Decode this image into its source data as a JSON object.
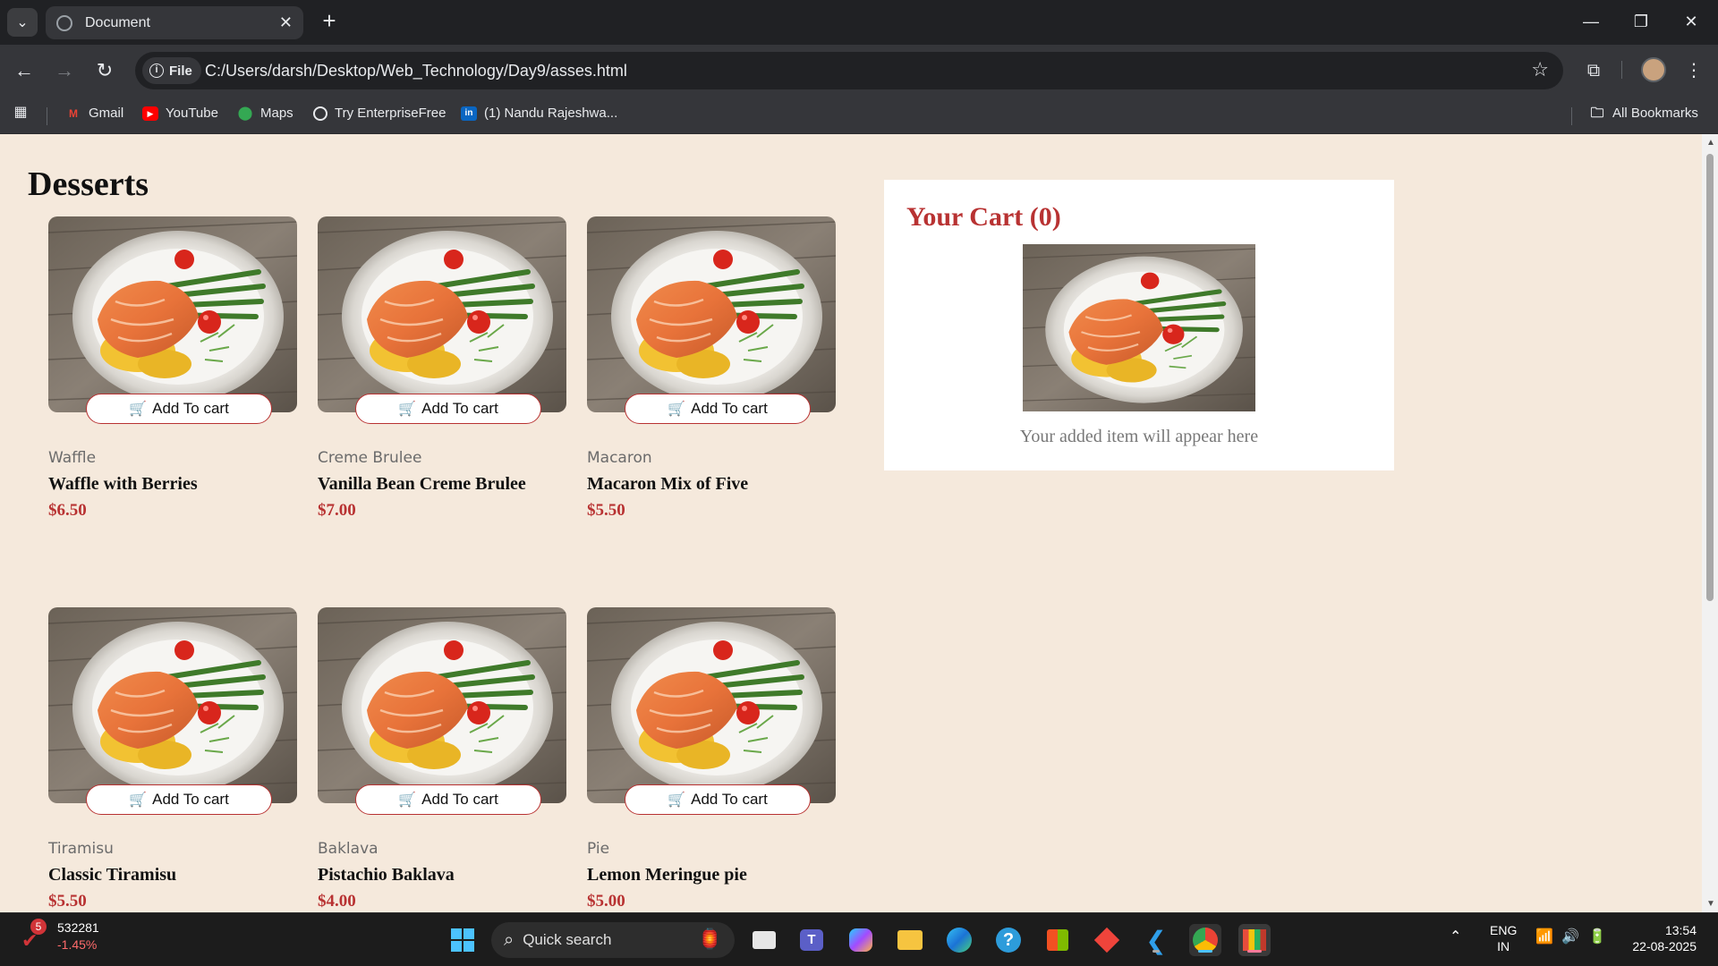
{
  "browser": {
    "tab_title": "Document",
    "url_scheme_label": "File",
    "url": "C:/Users/darsh/Desktop/Web_Technology/Day9/asses.html",
    "bookmarks": [
      "Gmail",
      "YouTube",
      "Maps",
      "Try EnterpriseFree",
      "(1) Nandu Rajeshwa...",
      "All Bookmarks"
    ]
  },
  "page": {
    "title": "Desserts",
    "add_label": "Add To cart",
    "products": [
      {
        "category": "Waffle",
        "name": "Waffle with Berries",
        "price": "$6.50"
      },
      {
        "category": "Creme Brulee",
        "name": "Vanilla Bean Creme Brulee",
        "price": "$7.00"
      },
      {
        "category": "Macaron",
        "name": "Macaron Mix of Five",
        "price": "$5.50"
      },
      {
        "category": "Tiramisu",
        "name": "Classic Tiramisu",
        "price": "$5.50"
      },
      {
        "category": "Baklava",
        "name": "Pistachio Baklava",
        "price": "$4.00"
      },
      {
        "category": "Pie",
        "name": "Lemon Meringue pie",
        "price": "$5.00"
      }
    ],
    "cart": {
      "title": "Your Cart (0)",
      "empty_text": "Your added item will appear here"
    }
  },
  "taskbar": {
    "stock_badge": "5",
    "stock_value": "532281",
    "stock_change": "-1.45%",
    "search_label": "Quick search",
    "lang_top": "ENG",
    "lang_bottom": "IN",
    "time": "13:54",
    "date": "22-08-2025"
  }
}
